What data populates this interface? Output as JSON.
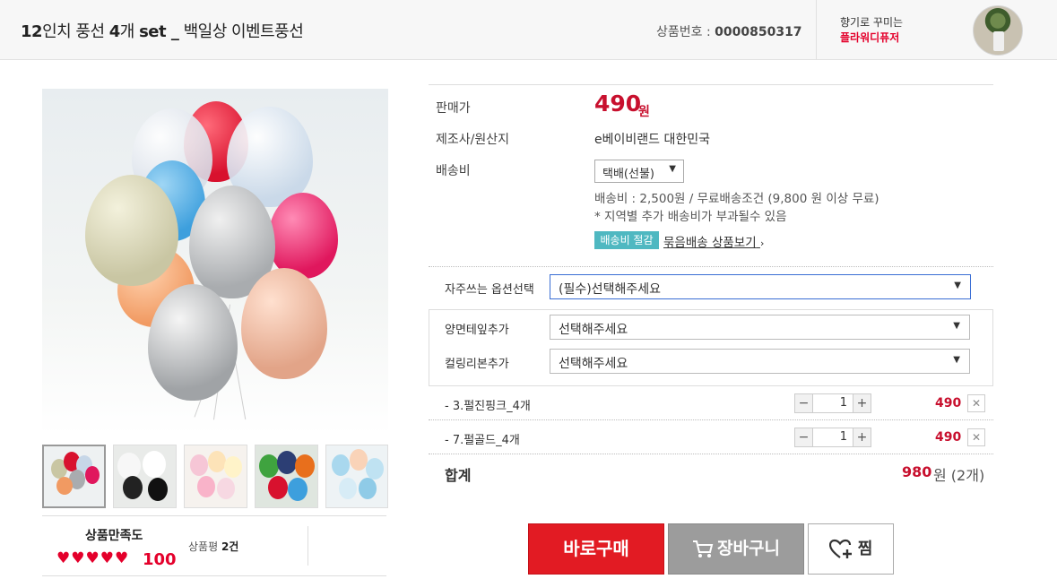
{
  "header": {
    "title_prefix": "12",
    "title_part1": "인치 풍선 ",
    "title_bold2": "4",
    "title_part2": "개 ",
    "title_bold3": "set _",
    "title_part3": " 백일상 이벤트풍선",
    "product_no_label": "상품번호 : ",
    "product_no": "0000850317",
    "brand_line1": "향기로 꾸미는",
    "brand_line2": "플라워디퓨저"
  },
  "gallery": {
    "main_image": "balloon-bouquet",
    "thumbnails": [
      "balloon-bouquet-mixed",
      "balloon-white-black",
      "balloon-pastel-pink",
      "balloon-green-orange",
      "balloon-pastel-blue"
    ]
  },
  "satisfaction": {
    "title": "상품만족도",
    "hearts": "♥♥♥♥♥",
    "score": "100",
    "review_label": "상품평 ",
    "review_count": "2건"
  },
  "info": {
    "price_label": "판매가",
    "price": "490",
    "price_unit": "원",
    "maker_label": "제조사/원산지",
    "maker": "e베이비랜드 대한민국",
    "shipping_label": "배송비",
    "shipping_select": "택배(선불)",
    "shipping_fee": "배송비 : 2,500원 / 무료배송조건 (9,800 원 이상 무료)",
    "shipping_note": "* 지역별 추가 배송비가 부과될수 있음",
    "badge": "배송비 절감",
    "bundle_link": "묶음배송 상품보기"
  },
  "options": {
    "frequent_label": "자주쓰는 옵션선택",
    "frequent_value": "(필수)선택해주세요",
    "tape_label": "양면테잎추가",
    "tape_value": "선택해주세요",
    "ribbon_label": "컬링리본추가",
    "ribbon_value": "선택해주세요"
  },
  "items": [
    {
      "name": "- 3.펄진핑크_4개",
      "qty": "1",
      "price": "490"
    },
    {
      "name": "- 7.펄골드_4개",
      "qty": "1",
      "price": "490"
    }
  ],
  "total": {
    "label": "합계",
    "price": "980",
    "unit": "원 (2개)"
  },
  "buttons": {
    "buy": "바로구매",
    "cart": "장바구니",
    "wish": "찜"
  },
  "colors": {
    "accent_red": "#c8102e",
    "buy_red": "#e21b23",
    "badge_teal": "#4fb8c1"
  }
}
